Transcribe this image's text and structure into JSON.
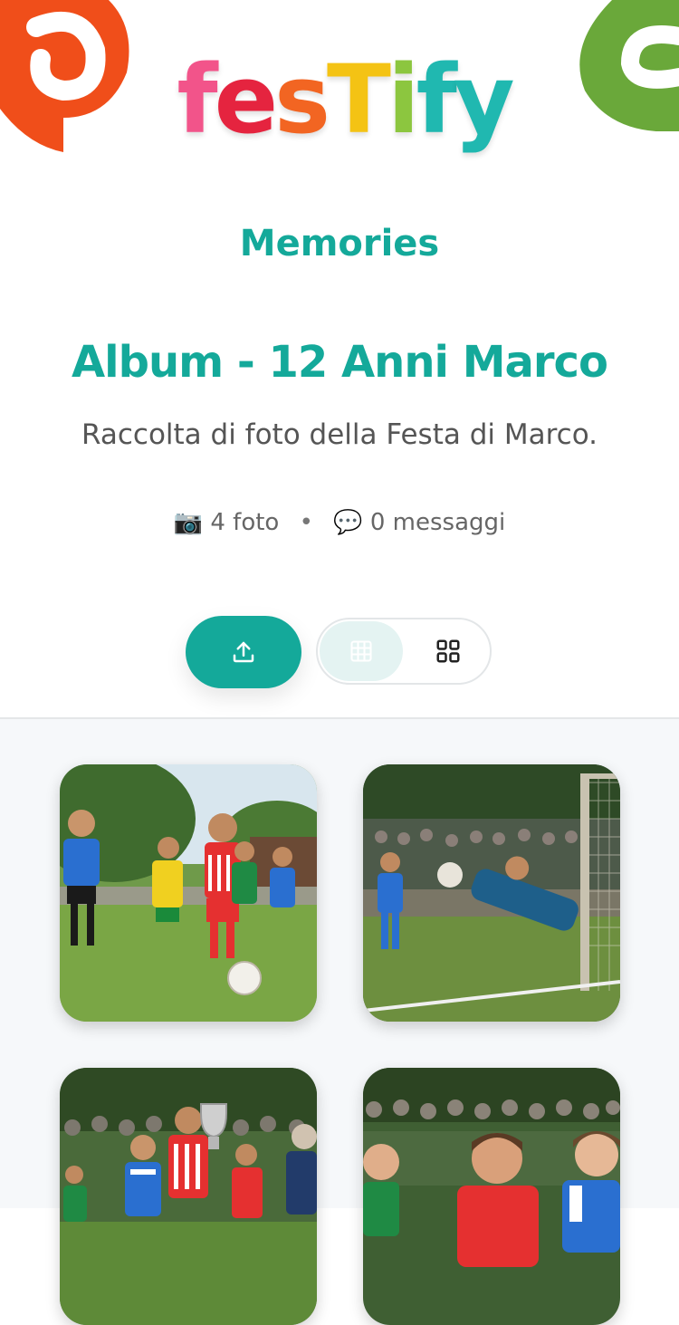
{
  "brand": {
    "logo_letters": [
      "f",
      "e",
      "s",
      "T",
      "i",
      "f",
      "y"
    ],
    "logo_colors": [
      "#f2548a",
      "#e5243f",
      "#f26522",
      "#f4c314",
      "#8cc63f",
      "#20b8b0",
      "#20b8b0"
    ],
    "subtitle": "Memories"
  },
  "album": {
    "title": "Album - 12 Anni Marco",
    "description": "Raccolta di foto della Festa di Marco.",
    "photo_count": "4 foto",
    "message_count": "0 messaggi",
    "separator": "•"
  },
  "toolbar": {
    "upload_icon": "upload-icon",
    "view_options": [
      "grid-dense-icon",
      "grid-large-icon"
    ],
    "active_view": "grid-dense"
  },
  "photos": [
    {
      "alt": "Kids playing football on a grass field"
    },
    {
      "alt": "Goalkeeper diving to save the ball"
    },
    {
      "alt": "Boy holding a trophy with teammates"
    },
    {
      "alt": "Smiling kids in football jerseys"
    }
  ],
  "colors": {
    "accent": "#14a99a",
    "gallery_bg": "#f6f8fa"
  }
}
